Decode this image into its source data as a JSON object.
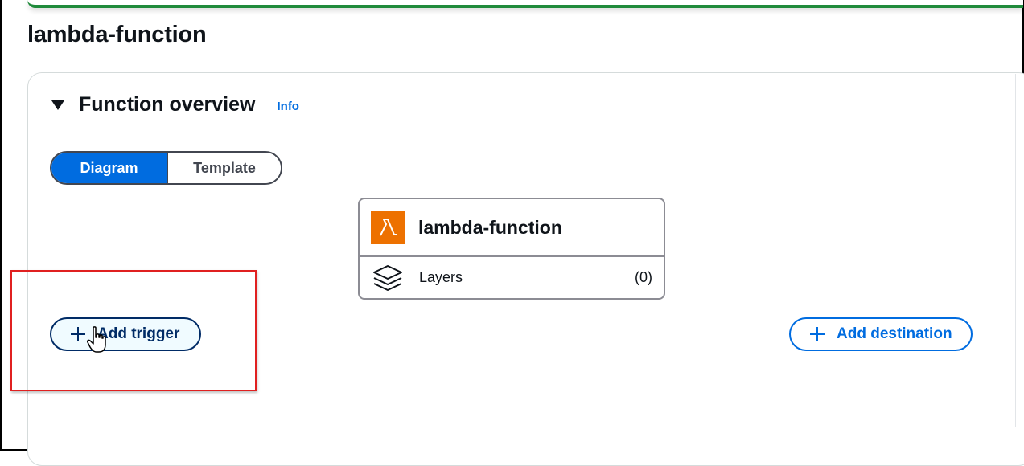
{
  "page": {
    "title": "lambda-function"
  },
  "function_overview": {
    "title": "Function overview",
    "info_link": "Info",
    "tabs": [
      {
        "label": "Diagram",
        "selected": true
      },
      {
        "label": "Template",
        "selected": false
      }
    ]
  },
  "diagram": {
    "function_card": {
      "icon": "lambda-icon",
      "name": "lambda-function",
      "layers_icon": "layers-icon",
      "layers_label": "Layers",
      "layers_count": "(0)"
    },
    "add_trigger_label": "Add trigger",
    "add_destination_label": "Add destination"
  },
  "colors": {
    "accent": "#006ce0",
    "success_bar": "#1f8a3b",
    "lambda_orange": "#ed7100",
    "highlight": "#e02020"
  }
}
